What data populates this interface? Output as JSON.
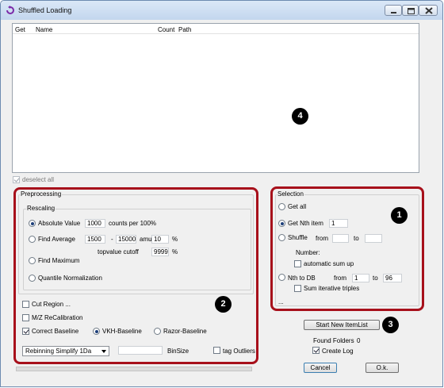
{
  "window": {
    "title": "Shuffled Loading"
  },
  "list": {
    "columns": [
      "Get",
      "Name",
      "Count",
      "Path"
    ]
  },
  "badges": {
    "list": "4",
    "selection": "1",
    "preprocessing": "2",
    "new_item_list": "3"
  },
  "deselect_all": {
    "label": "deselect all",
    "checked": true,
    "disabled": true
  },
  "preprocessing": {
    "title": "Preprocessing",
    "rescaling": {
      "title": "Rescaling",
      "absolute_value": {
        "label": "Absolute Value",
        "value": "1000",
        "unit": "counts per 100%",
        "selected": true
      },
      "find_average": {
        "label": "Find Average",
        "from": "1500",
        "dash": "-",
        "to": "15000",
        "unit": "amu",
        "percent": "10",
        "percent_sign": "%",
        "selected": false
      },
      "topvalue_cutoff": {
        "label": "topvalue cutoff",
        "value": "9999",
        "unit": "%"
      },
      "find_maximum": {
        "label": "Find Maximum",
        "selected": false
      },
      "quantile_normalization": {
        "label": "Quantile Normalization",
        "selected": false
      }
    },
    "cut_region": {
      "label": "Cut Region ...",
      "checked": false
    },
    "mz_recalibration": {
      "label": "M/Z ReCalibration",
      "checked": false
    },
    "correct_baseline": {
      "label": "Correct Baseline",
      "checked": true
    },
    "vkh_baseline": {
      "label": "VKH-Baseline",
      "selected": true
    },
    "razor_baseline": {
      "label": "Razor-Baseline",
      "selected": false
    },
    "rebinning": {
      "selected": "Rebinning Simplify 1Da"
    },
    "binsize": {
      "label": "BinSize",
      "value": ""
    },
    "tag_outliers": {
      "label": "tag Outliers",
      "checked": false
    }
  },
  "selection": {
    "title": "Selection",
    "get_all": {
      "label": "Get all",
      "selected": false
    },
    "get_nth": {
      "label": "Get Nth item",
      "value": "1",
      "selected": true
    },
    "shuffle": {
      "label": "Shuffle",
      "from_label": "from",
      "to_label": "to",
      "from": "",
      "to": "",
      "selected": false
    },
    "number_label": "Number:",
    "automatic_sum_up": {
      "label": "automatic sum up",
      "checked": false
    },
    "nth_to_db": {
      "label": "Nth to DB",
      "from_label": "from",
      "from": "1",
      "to_label": "to",
      "to": "96",
      "selected": false
    },
    "sum_iterative": {
      "label": "Sum iterative triples",
      "checked": false
    },
    "more": "..."
  },
  "actions": {
    "start_new_item_list": "Start New ItemList",
    "found_folders_label": "Found Folders",
    "found_folders_value": "0",
    "create_log": {
      "label": "Create Log",
      "checked": true
    },
    "cancel": "Cancel",
    "ok": "O.k."
  },
  "colors": {
    "highlight_frame": "#a7101b",
    "title_bar": "#c3d6ee"
  }
}
